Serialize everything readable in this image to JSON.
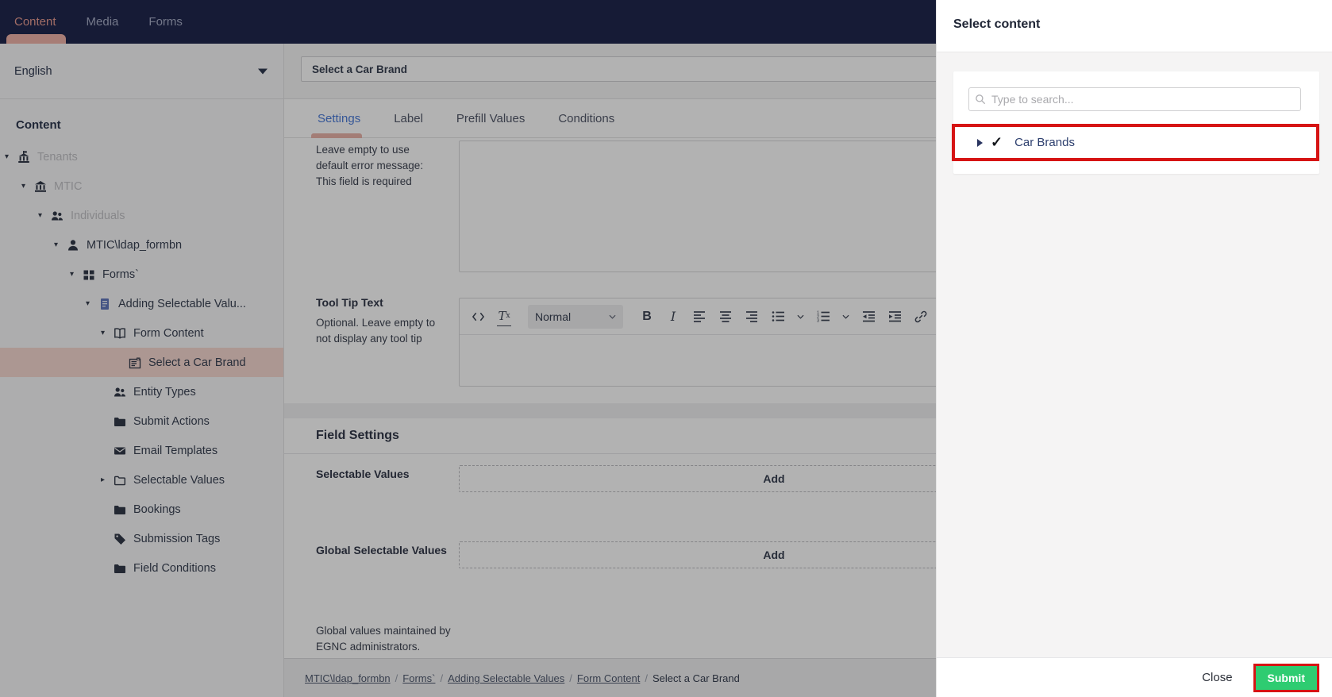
{
  "colors": {
    "navbar_bg": "#20284e",
    "accent_salmon": "#e89d92",
    "selected_row_bg": "#f6d9d2",
    "active_tab_blue": "#4c7cd8",
    "annotation_red": "#d61414",
    "submit_green": "#2ecc71"
  },
  "navbar": {
    "tabs": [
      {
        "label": "Content",
        "active": true
      },
      {
        "label": "Media",
        "active": false
      },
      {
        "label": "Forms",
        "active": false
      }
    ]
  },
  "sidebar": {
    "language": "English",
    "heading": "Content",
    "tree": [
      {
        "label": "Tenants",
        "icon": "tenants-icon",
        "state": "expanded",
        "muted": true
      },
      {
        "label": "MTIC",
        "icon": "bank-icon",
        "state": "expanded",
        "muted": true
      },
      {
        "label": "Individuals",
        "icon": "people-icon",
        "state": "expanded",
        "muted": true
      },
      {
        "label": "MTIC\\ldap_formbn",
        "icon": "person-icon",
        "state": "expanded",
        "muted": false
      },
      {
        "label": "Forms`",
        "icon": "grid-icon",
        "state": "expanded",
        "muted": false
      },
      {
        "label": "Adding Selectable Valu...",
        "icon": "document-icon",
        "state": "expanded",
        "muted": false
      },
      {
        "label": "Form Content",
        "icon": "book-icon",
        "state": "expanded",
        "muted": false
      },
      {
        "label": "Select a Car Brand",
        "icon": "form-field-icon",
        "state": "selected",
        "muted": false
      },
      {
        "label": "Entity Types",
        "icon": "people-icon",
        "state": "none",
        "muted": false
      },
      {
        "label": "Submit Actions",
        "icon": "folder-icon",
        "state": "none",
        "muted": false
      },
      {
        "label": "Email Templates",
        "icon": "mail-icon",
        "state": "none",
        "muted": false
      },
      {
        "label": "Selectable Values",
        "icon": "folder-open-icon",
        "state": "collapsed",
        "muted": false
      },
      {
        "label": "Bookings",
        "icon": "folder-icon",
        "state": "none",
        "muted": false
      },
      {
        "label": "Submission Tags",
        "icon": "tag-icon",
        "state": "none",
        "muted": false
      },
      {
        "label": "Field Conditions",
        "icon": "folder-icon",
        "state": "none",
        "muted": false
      }
    ]
  },
  "main": {
    "field_name_value": "Select a Car Brand",
    "tabs": [
      {
        "label": "Settings",
        "active": true
      },
      {
        "label": "Label",
        "active": false
      },
      {
        "label": "Prefill Values",
        "active": false
      },
      {
        "label": "Conditions",
        "active": false
      }
    ],
    "error_row": {
      "help": "Leave empty to use default error message: This field is required"
    },
    "tooltip_row": {
      "label": "Tool Tip Text",
      "help": "Optional. Leave empty to not display any tool tip",
      "editor": {
        "paragraph_style": "Normal"
      }
    },
    "field_settings": {
      "title": "Field Settings",
      "selectable_values": {
        "label": "Selectable Values",
        "add_label": "Add"
      },
      "global_selectable_values": {
        "label": "Global Selectable Values",
        "add_label": "Add",
        "help": "Global values maintained by EGNC administrators."
      }
    },
    "breadcrumb": {
      "separator": "/",
      "items": [
        {
          "label": "MTIC\\ldap_formbn",
          "link": true
        },
        {
          "label": "Forms`",
          "link": true
        },
        {
          "label": "Adding Selectable Values",
          "link": true
        },
        {
          "label": "Form Content",
          "link": true
        },
        {
          "label": "Select a Car Brand",
          "link": false
        }
      ]
    }
  },
  "panel": {
    "title": "Select content",
    "search_placeholder": "Type to search...",
    "items": [
      {
        "label": "Car Brands",
        "checked": true,
        "annotated": true
      }
    ],
    "close_label": "Close",
    "submit_label": "Submit"
  }
}
